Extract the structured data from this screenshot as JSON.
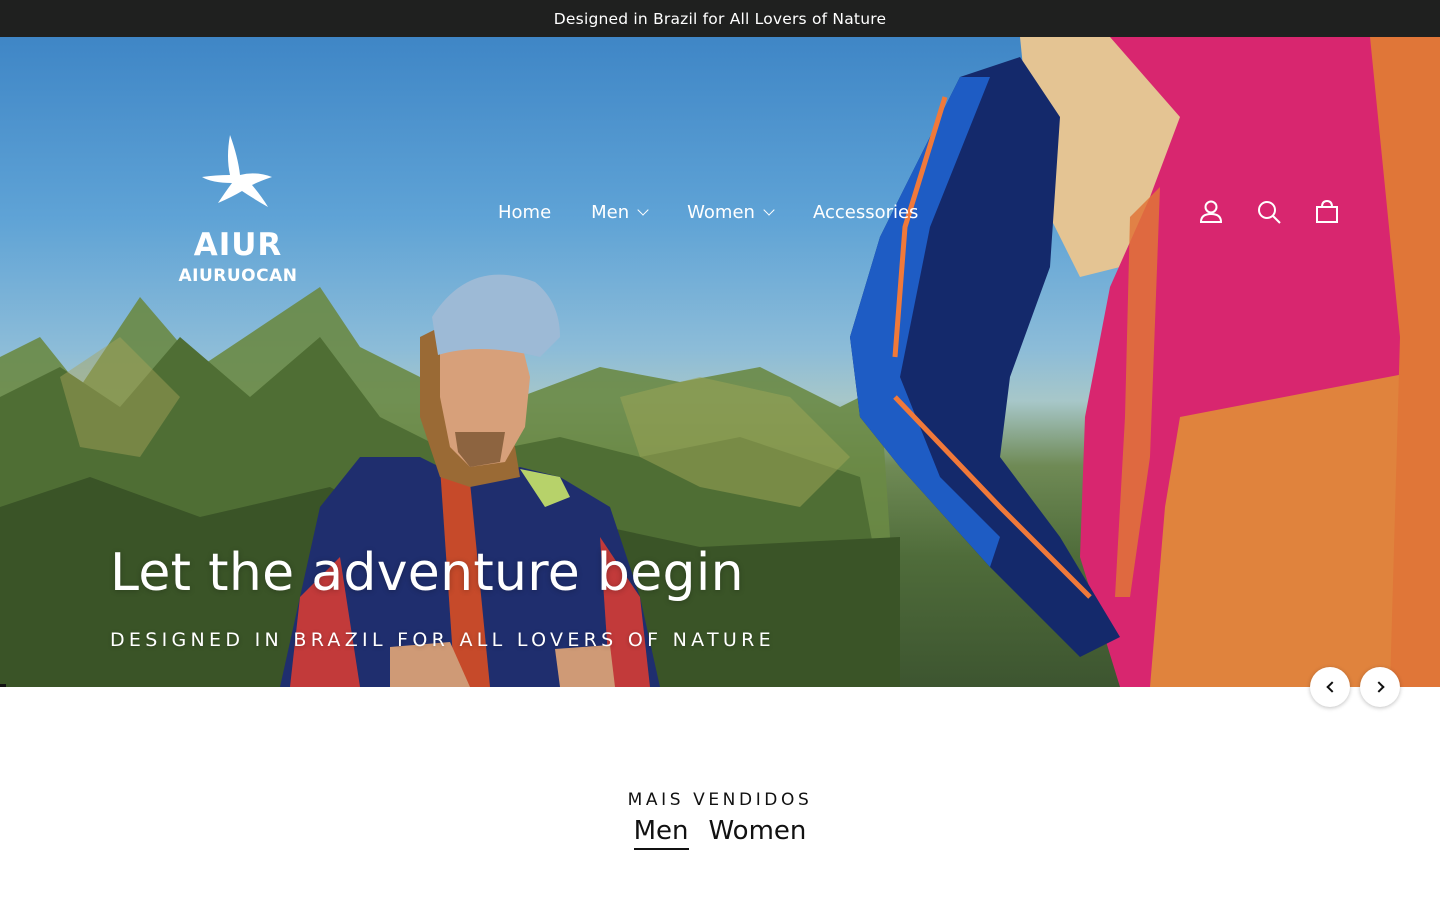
{
  "announcement": {
    "text": "Designed in Brazil for All Lovers of Nature"
  },
  "logo": {
    "brand": "AIUR",
    "sub": "AIURUOCAN"
  },
  "nav": {
    "items": [
      {
        "label": "Home"
      },
      {
        "label": "Men"
      },
      {
        "label": "Women"
      },
      {
        "label": "Accessories"
      }
    ]
  },
  "header_icons": [
    "account-icon",
    "search-icon",
    "cart-icon"
  ],
  "hero": {
    "title": "Let the adventure begin",
    "subtitle": "DESIGNED IN BRAZIL FOR ALL LOVERS OF NATURE"
  },
  "bestsellers": {
    "title": "MAIS VENDIDOS",
    "tabs": [
      {
        "label": "Men",
        "active": true
      },
      {
        "label": "Women",
        "active": false
      }
    ]
  },
  "colors": {
    "announcement_bg": "#1f201f",
    "text_dark": "#111111",
    "white": "#ffffff"
  }
}
